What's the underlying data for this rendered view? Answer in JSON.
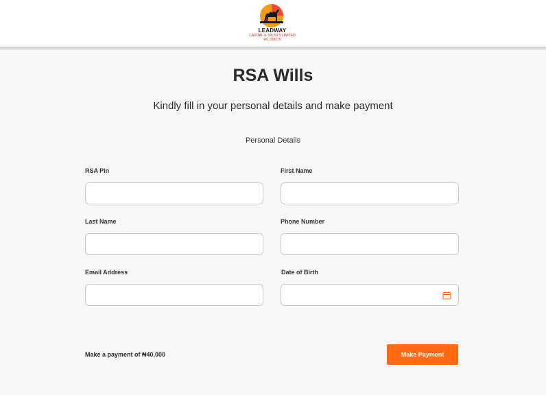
{
  "brand": {
    "name": "LEADWAY",
    "subtitle": "CAPITAL & TRUSTS LIMITED",
    "rc": "RC 288275"
  },
  "page": {
    "title": "RSA Wills",
    "subtitle": "Kindly fill in your personal details and make payment",
    "section_title": "Personal Details"
  },
  "form": {
    "rsa_pin": {
      "label": "RSA Pin",
      "value": "",
      "placeholder": ""
    },
    "first_name": {
      "label": "First Name",
      "value": "",
      "placeholder": ""
    },
    "last_name": {
      "label": "Last Name",
      "value": "",
      "placeholder": ""
    },
    "phone_number": {
      "label": "Phone Number",
      "value": "",
      "placeholder": ""
    },
    "email_address": {
      "label": "Email Address",
      "value": "",
      "placeholder": ""
    },
    "date_of_birth": {
      "label": "Date of Birth",
      "value": "",
      "placeholder": "",
      "icon": "calendar-icon"
    }
  },
  "payment": {
    "text": "Make a payment of ₦40,000",
    "button_label": "Make Payment",
    "button_color": "#ff6a13"
  }
}
